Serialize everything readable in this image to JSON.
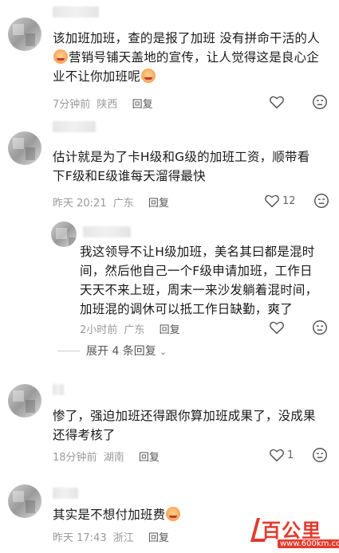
{
  "comments": [
    {
      "lines": [
        "该加班加班，查的是报了加班 没有拼命干活的人",
        "营销号铺天盖地的宣传，让人觉得这是良心企",
        "业不让你加班呢"
      ],
      "time": "7分钟前",
      "location": "陕西",
      "reply": "回复",
      "likes": ""
    },
    {
      "lines": [
        "估计就是为了卡H级和G级的加班工资，顺带看",
        "下F级和E级谁每天溜得最快"
      ],
      "time": "昨天 20:21",
      "location": "广东",
      "reply": "回复",
      "likes": "12"
    },
    {
      "lines": [
        "我这领导不让H级加班，美名其曰都是混时",
        "间，然后他自己一个F级申请加班，工作日",
        "天天不来上班，周末一来沙发躺着混时间，",
        "加班混的调休可以抵工作日缺勤，爽了"
      ],
      "time": "2小时前",
      "location": "广东",
      "reply": "回复",
      "likes": ""
    },
    {
      "lines": [
        "惨了，强迫加班还得跟你算加班成果了，没成果",
        "还得考核了"
      ],
      "time": "18分钟前",
      "location": "湖南",
      "reply": "回复",
      "likes": "1"
    },
    {
      "lines": [
        "其实是不想付加班费"
      ],
      "time": "昨天 17:43",
      "location": "浙江",
      "reply": "回复",
      "likes": ""
    }
  ],
  "expand_replies": "展开 4 条回复",
  "watermark": {
    "brand": "百公里",
    "url": "www.600km.com"
  },
  "colors": {
    "text": "#1a1a1a",
    "meta": "#9a9a9a",
    "watermark": "#e23b2e"
  },
  "icons": [
    "heart-icon",
    "dislike-face-icon",
    "chevron-down-icon",
    "laugh-emoji-icon"
  ]
}
